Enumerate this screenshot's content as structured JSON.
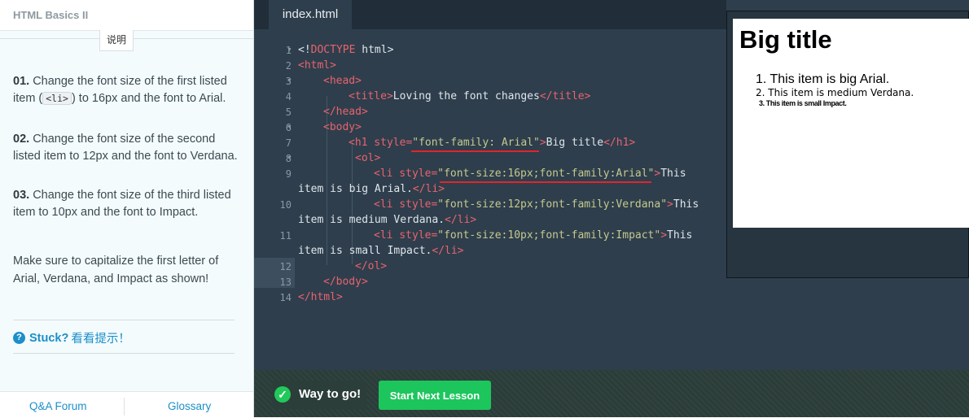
{
  "course": {
    "title": "HTML Basics II",
    "tab_label": "说明"
  },
  "instructions": {
    "i1": {
      "num": "01.",
      "pre": " Change the font size of the first listed item (",
      "code": "<li>",
      "post": ") to 16px and the font to Arial."
    },
    "i2": {
      "num": "02.",
      "text": " Change the font size of the second listed item to 12px and the font to Verdana."
    },
    "i3": {
      "num": "03.",
      "text": " Change the font size of the third listed item to 10px and the font to Impact."
    },
    "note": "Make sure to capitalize the first letter of Arial, Verdana, and Impact as shown!"
  },
  "stuck": {
    "icon": "question-icon",
    "label": "Stuck?",
    "hint": "看看提示！"
  },
  "footer": {
    "qa": "Q&A Forum",
    "glossary": "Glossary"
  },
  "editor": {
    "file_tab": "index.html",
    "line_numbers": [
      "1",
      "2",
      "3",
      "4",
      "5",
      "6",
      "7",
      "8",
      "9",
      "10",
      "11",
      "12",
      "13",
      "14"
    ],
    "code": {
      "l1_a": "<!",
      "l1_b": "DOCTYPE",
      "l1_c": " html>",
      "l2": "<html>",
      "l3": "<head>",
      "l4_a": "<title>",
      "l4_b": "Loving the font changes",
      "l4_c": "</title>",
      "l5": "</head>",
      "l6": "<body>",
      "l7_a": "<h1 style=",
      "l7_b": "\"font-family: Arial\"",
      "l7_c": ">",
      "l7_d": "Big title",
      "l7_e": "</h1>",
      "l8": "<ol>",
      "l9_a": "<li style=",
      "l9_b": "\"font-size:16px;font-family:Arial\"",
      "l9_c": ">",
      "l9_d": "This",
      "l9w_a": "item is big Arial.",
      "l9w_b": "</li>",
      "l10_a": "<li style=",
      "l10_b": "\"font-size:12px;font-family:Verdana\"",
      "l10_c": ">",
      "l10_d": "This",
      "l10w_a": "item is medium Verdana.",
      "l10w_b": "</li>",
      "l11_a": "<li style=",
      "l11_b": "\"font-size:10px;font-family:Impact\"",
      "l11_c": ">",
      "l11_d": "This",
      "l11w_a": "item is small Impact.",
      "l11w_b": "</li>",
      "l12": "</ol>",
      "l13": "</body>",
      "l14": "</html>"
    }
  },
  "preview": {
    "title": "Big title",
    "items": [
      "1.  This item is big Arial.",
      "2.  This item is medium Verdana.",
      "3.  This item is small Impact."
    ]
  },
  "bottom": {
    "success_icon": "check-circle-icon",
    "success_text": "Way to go!",
    "next_button": "Start Next Lesson"
  },
  "colors": {
    "accent_green": "#1dc55d",
    "link_blue": "#1b8fc9",
    "tag_red": "#e8636f",
    "string_yellow": "#c5c98e",
    "editor_bg": "#2e3e4c"
  }
}
